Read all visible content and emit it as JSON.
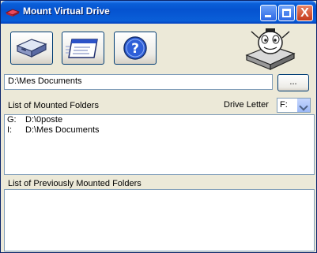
{
  "window": {
    "title": "Mount Virtual Drive",
    "close_glyph": "X"
  },
  "toolbar": {
    "buttons": [
      {
        "name": "mount-drive-button",
        "icon": "drive-icon"
      },
      {
        "name": "window-button",
        "icon": "window-icon"
      },
      {
        "name": "help-button",
        "icon": "help-icon"
      }
    ]
  },
  "path_input": {
    "value": "D:\\Mes Documents"
  },
  "browse_button": {
    "label": "..."
  },
  "mounted": {
    "header": "List of Mounted Folders",
    "drive_letter_label": "Drive Letter",
    "drive_letter_value": "F:",
    "rows": [
      {
        "letter": "G:",
        "path": "D:\\0poste"
      },
      {
        "letter": "I:",
        "path": "D:\\Mes Documents"
      }
    ]
  },
  "previous": {
    "header": "List of Previously Mounted Folders"
  },
  "colors": {
    "titlebar": "#0553d0",
    "face": "#ece9d8",
    "border": "#7f9db9"
  }
}
